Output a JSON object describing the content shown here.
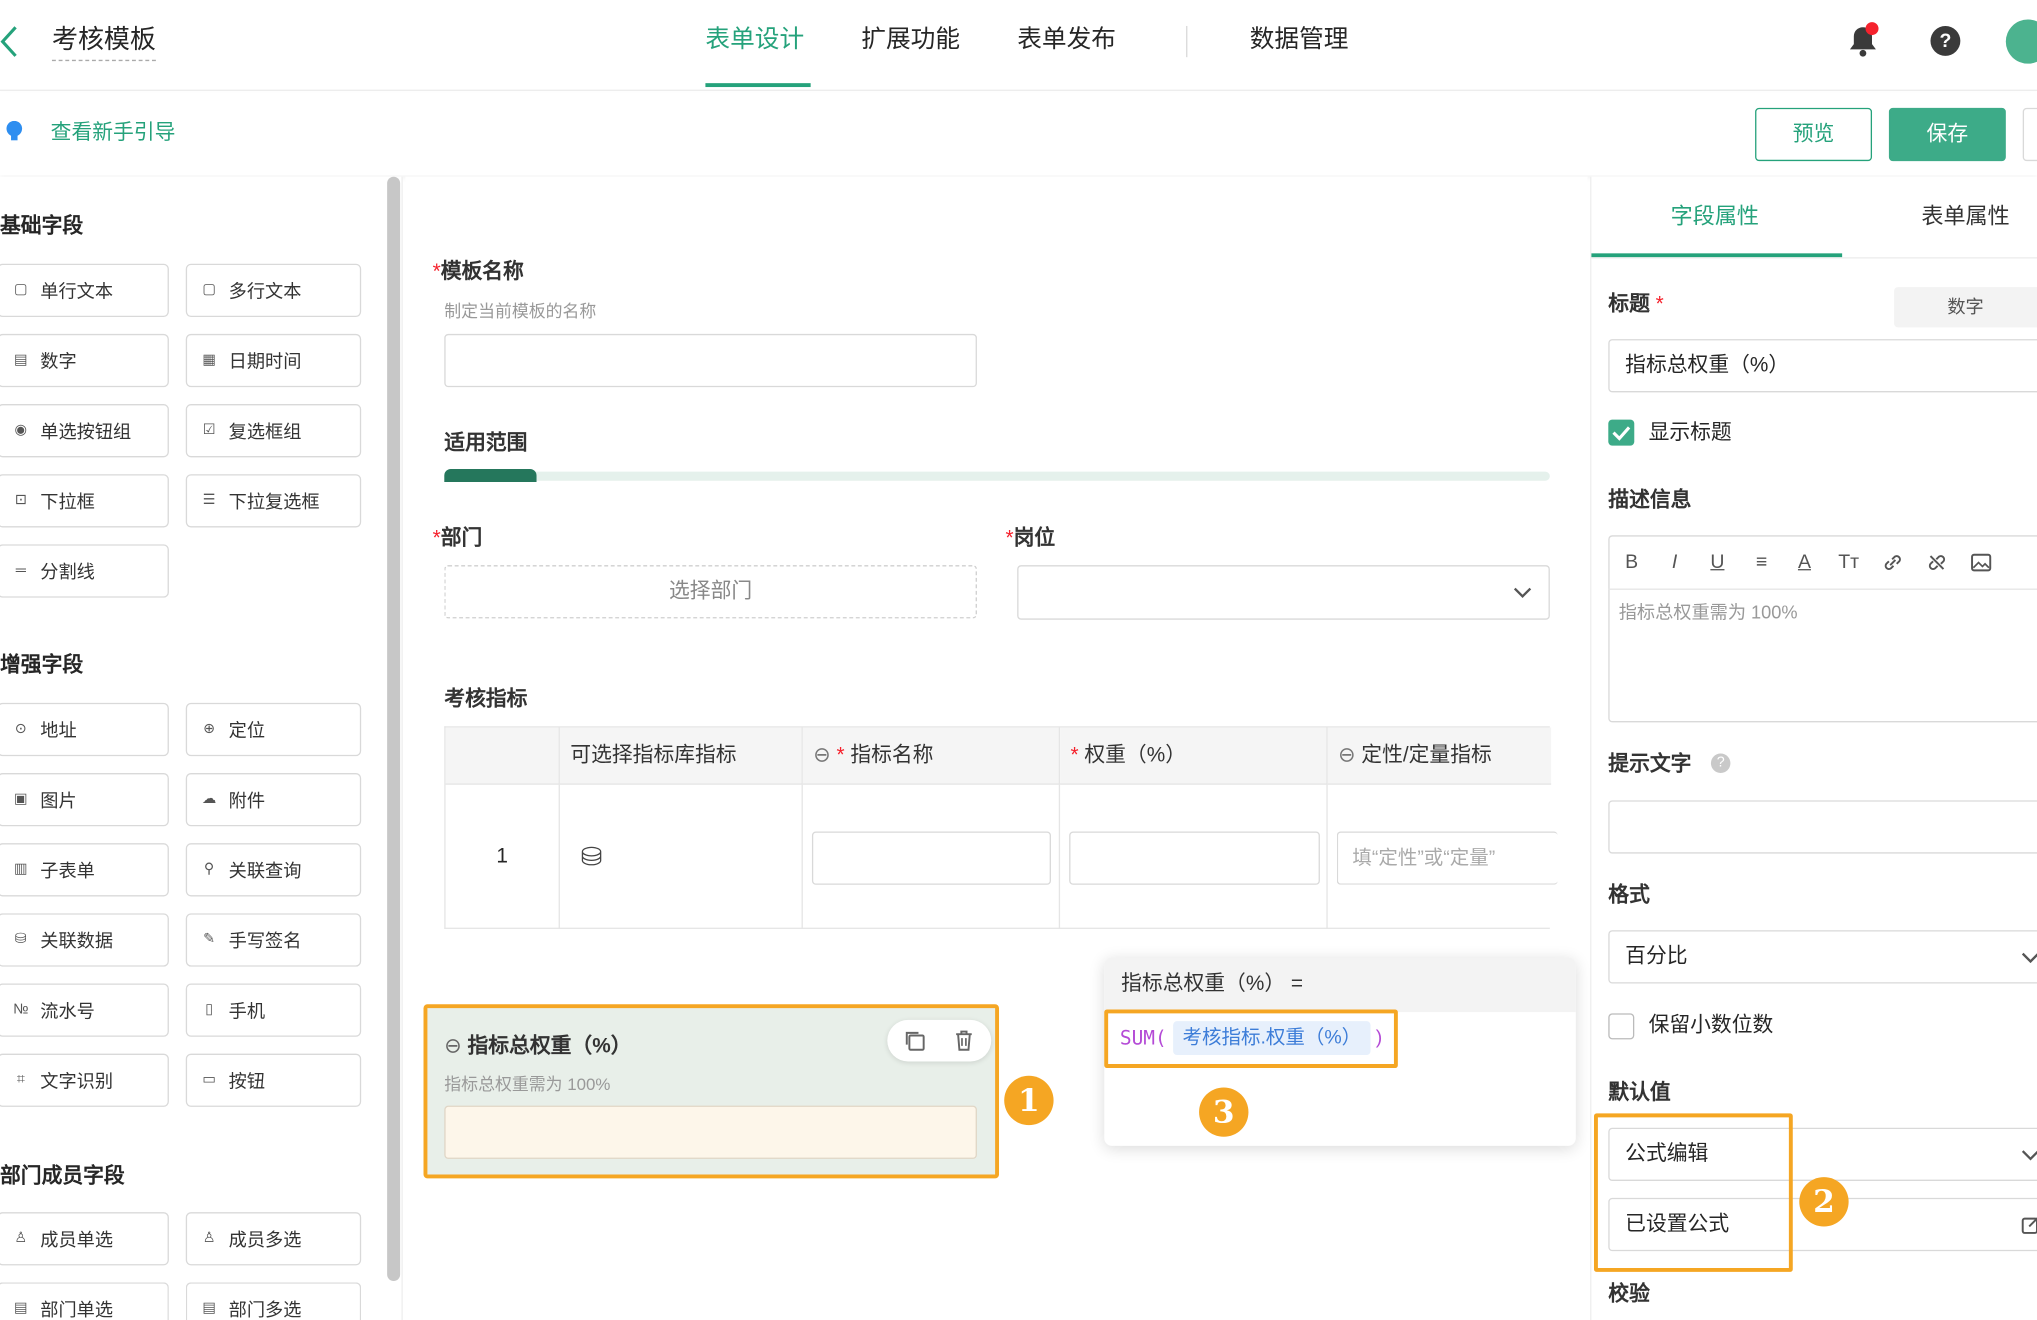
{
  "header": {
    "title": "考核模板",
    "tabs": [
      "表单设计",
      "扩展功能",
      "表单发布",
      "数据管理"
    ]
  },
  "subbar": {
    "guide": "查看新手引导",
    "preview": "预览",
    "save": "保存"
  },
  "palette": {
    "basic_title": "基础字段",
    "basic": [
      "单行文本",
      "多行文本",
      "数字",
      "日期时间",
      "单选按钮组",
      "复选框组",
      "下拉框",
      "下拉复选框",
      "分割线"
    ],
    "enhanced_title": "增强字段",
    "enhanced": [
      "地址",
      "定位",
      "图片",
      "附件",
      "子表单",
      "关联查询",
      "关联数据",
      "手写签名",
      "流水号",
      "手机",
      "文字识别",
      "按钮"
    ],
    "member_title": "部门成员字段",
    "member": [
      "成员单选",
      "成员多选",
      "部门单选",
      "部门多选"
    ]
  },
  "form": {
    "name_label": "模板名称",
    "name_hint": "制定当前模板的名称",
    "scope_label": "适用范围",
    "dept_label": "部门",
    "dept_placeholder": "选择部门",
    "pos_label": "岗位",
    "index_label": "考核指标",
    "table_headers": [
      "可选择指标库指标",
      "指标名称",
      "权重（%）",
      "定性/定量指标"
    ],
    "row_no": "1",
    "qual_placeholder": "填“定性”或“定量”",
    "field_title": "指标总权重（%）",
    "field_desc": "指标总权重需为 100%"
  },
  "formula": {
    "head": "指标总权重（%） =",
    "fn": "SUM(",
    "arg": "考核指标.权重（%）",
    "close": ")"
  },
  "badges": [
    "1",
    "2",
    "3"
  ],
  "props": {
    "tabs": [
      "字段属性",
      "表单属性"
    ],
    "title_label": "标题",
    "type_tag": "数字",
    "title_value": "指标总权重（%）",
    "show_title": "显示标题",
    "desc_label": "描述信息",
    "desc_toolbar": [
      "B",
      "I",
      "U",
      "≡",
      "A",
      "Tт"
    ],
    "desc_text": "指标总权重需为 100%",
    "hint_label": "提示文字",
    "format_label": "格式",
    "format_value": "百分比",
    "keep_decimal": "保留小数位数",
    "default_label": "默认值",
    "default_mode": "公式编辑",
    "default_set": "已设置公式",
    "validate_label": "校验"
  },
  "colors": {
    "accent": "#25a27b",
    "highlight": "#f5a623"
  }
}
